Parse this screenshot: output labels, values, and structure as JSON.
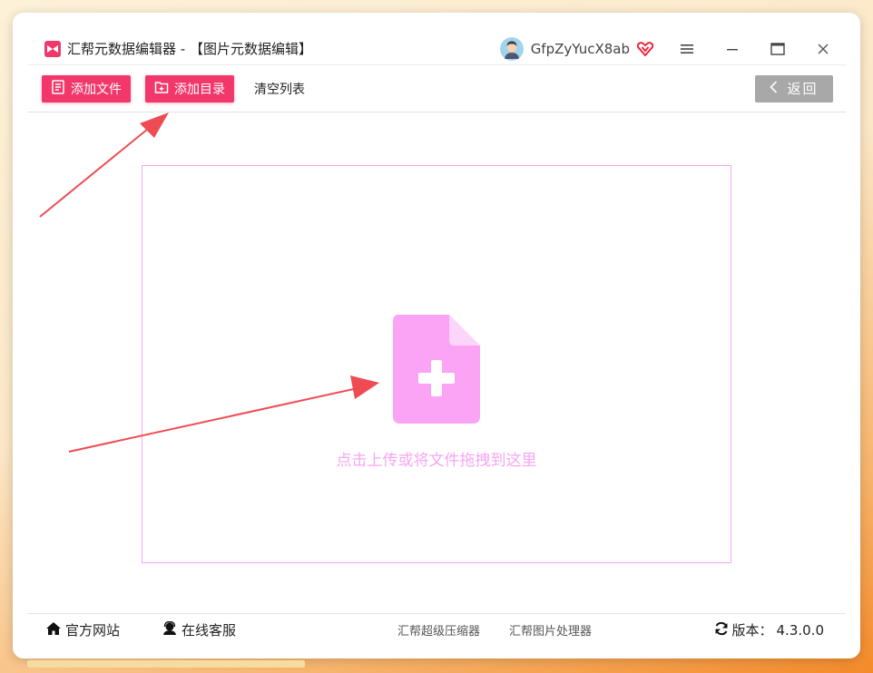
{
  "window": {
    "title": "汇帮元数据编辑器 - 【图片元数据编辑】",
    "username": "GfpZyYucX8ab",
    "brand_color": "#f2386b",
    "accent_pink": "#f7a6f2"
  },
  "toolbar": {
    "add_file_label": "添加文件",
    "add_folder_label": "添加目录",
    "clear_list_label": "清空列表",
    "back_label": "返回"
  },
  "dropzone": {
    "hint": "点击上传或将文件拖拽到这里",
    "icon": "file-add-icon"
  },
  "footer": {
    "website_label": "官方网站",
    "service_label": "在线客服",
    "app1_label": "汇帮超级压缩器",
    "app2_label": "汇帮图片处理器",
    "version_label": "版本：",
    "version_value": "4.3.0.0"
  }
}
